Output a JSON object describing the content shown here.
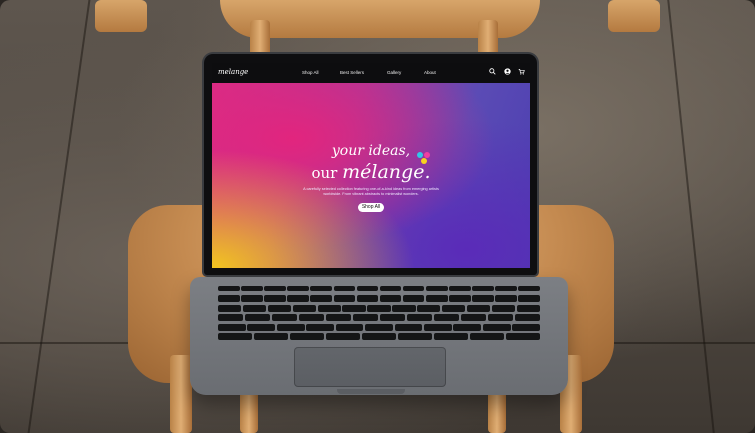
{
  "nav": {
    "logo": "melange",
    "items": [
      "Shop All",
      "Best Sellers",
      "Gallery",
      "About"
    ],
    "icons": [
      "search-icon",
      "account-icon",
      "cart-icon"
    ]
  },
  "hero": {
    "line1": "your ideas,",
    "line2_prefix": "our",
    "line2_brand": "mélange.",
    "subtitle": "A carefully selected collection featuring one-of-a-kind ideas from emerging artists worldwide. From vibrant abstracts to minimalist wonders.",
    "cta": "Shop All",
    "dot_colors": [
      "#31c7e8",
      "#f03ea1",
      "#f7d21f"
    ]
  }
}
